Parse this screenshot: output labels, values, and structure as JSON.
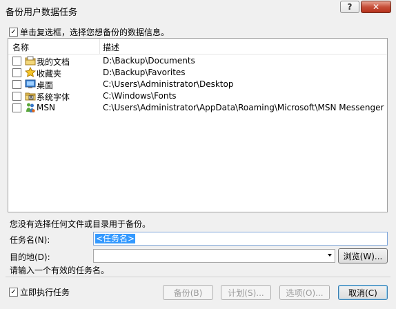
{
  "window": {
    "title": "备份用户数据任务",
    "help_label": "?",
    "close_label": "✕"
  },
  "select_checkbox": {
    "label": "单击复选框，选择您想备份的数据信息。",
    "checked_mark": "✓"
  },
  "list": {
    "columns": {
      "name": "名称",
      "description": "描述"
    },
    "rows": [
      {
        "name": "我的文档",
        "path": "D:\\Backup\\Documents",
        "icon": "documents-icon"
      },
      {
        "name": "收藏夹",
        "path": "D:\\Backup\\Favorites",
        "icon": "favorites-star-icon"
      },
      {
        "name": "桌面",
        "path": "C:\\Users\\Administrator\\Desktop",
        "icon": "desktop-icon"
      },
      {
        "name": "系统字体",
        "path": "C:\\Windows\\Fonts",
        "icon": "fonts-folder-icon"
      },
      {
        "name": "MSN",
        "path": "C:\\Users\\Administrator\\AppData\\Roaming\\Microsoft\\MSN Messenger",
        "icon": "msn-icon"
      }
    ]
  },
  "status_text": "您没有选择任何文件或目录用于备份。",
  "task_name": {
    "label": "任务名(N):",
    "value": "<任务名>"
  },
  "destination": {
    "label": "目的地(D):",
    "value": ""
  },
  "browse_label": "浏览(W)...",
  "hint_text": "请输入一个有效的任务名。",
  "run_now": {
    "label": "立即执行任务",
    "checked_mark": "✓"
  },
  "buttons": {
    "backup": "备份(B)",
    "schedule": "计划(S)...",
    "options": "选项(O)...",
    "cancel": "取消(C)"
  }
}
